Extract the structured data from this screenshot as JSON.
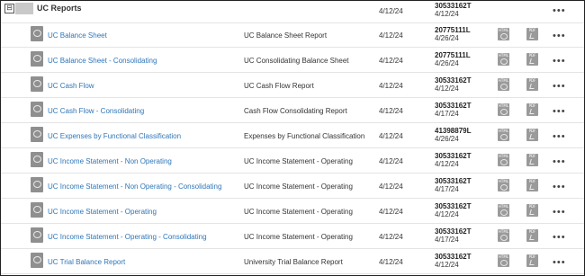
{
  "folder": {
    "toggle": "⊟",
    "title": "UC Reports",
    "date": "4/12/24",
    "owner": "30533162T",
    "modified": "4/12/24",
    "more": "•••"
  },
  "format_labels": {
    "html": "HTML",
    "pdf": "PDF"
  },
  "items": [
    {
      "name": "UC Balance Sheet",
      "description": "UC Balance Sheet Report",
      "date": "4/12/24",
      "owner": "20775111L",
      "modified": "4/26/24",
      "more": "•••"
    },
    {
      "name": "UC Balance Sheet - Consolidating",
      "description": "UC Consolidating Balance Sheet",
      "date": "4/12/24",
      "owner": "20775111L",
      "modified": "4/26/24",
      "more": "•••"
    },
    {
      "name": "UC Cash Flow",
      "description": "UC Cash Flow Report",
      "date": "4/12/24",
      "owner": "30533162T",
      "modified": "4/12/24",
      "more": "•••"
    },
    {
      "name": "UC Cash Flow - Consolidating",
      "description": "Cash Flow Consolidating Report",
      "date": "4/12/24",
      "owner": "30533162T",
      "modified": "4/17/24",
      "more": "•••"
    },
    {
      "name": "UC Expenses by Functional Classification",
      "description": "Expenses by Functional Classification",
      "date": "4/12/24",
      "owner": "41398879L",
      "modified": "4/26/24",
      "more": "•••"
    },
    {
      "name": "UC Income Statement - Non Operating",
      "description": "UC Income Statement - Operating",
      "date": "4/12/24",
      "owner": "30533162T",
      "modified": "4/12/24",
      "more": "•••"
    },
    {
      "name": "UC Income Statement - Non Operating - Consolidating",
      "description": "UC Income Statement - Operating",
      "date": "4/12/24",
      "owner": "30533162T",
      "modified": "4/17/24",
      "more": "•••"
    },
    {
      "name": "UC Income Statement - Operating",
      "description": "UC Income Statement - Operating",
      "date": "4/12/24",
      "owner": "30533162T",
      "modified": "4/12/24",
      "more": "•••"
    },
    {
      "name": "UC Income Statement - Operating - Consolidating",
      "description": "UC Income Statement - Operating",
      "date": "4/12/24",
      "owner": "30533162T",
      "modified": "4/17/24",
      "more": "•••"
    },
    {
      "name": "UC Trial Balance Report",
      "description": "University Trial Balance Report",
      "date": "4/12/24",
      "owner": "30533162T",
      "modified": "4/12/24",
      "more": "•••"
    }
  ]
}
